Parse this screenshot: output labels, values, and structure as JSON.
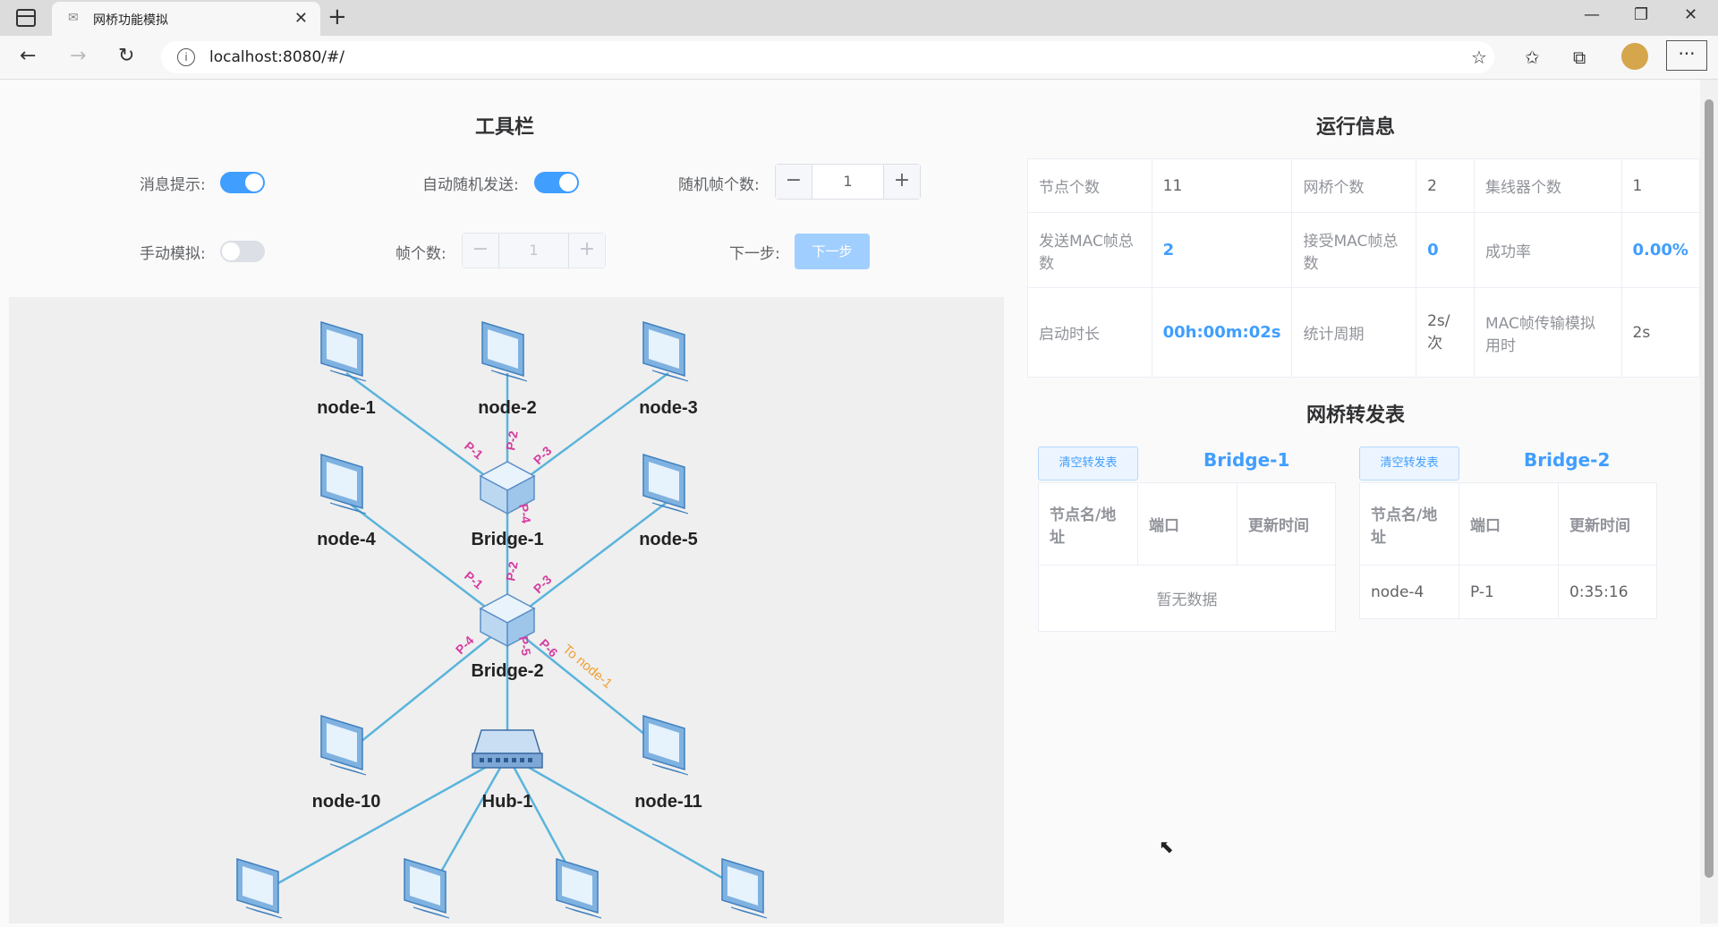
{
  "browser": {
    "tab_title": "网桥功能模拟",
    "url": "localhost:8080/#/"
  },
  "toolbar": {
    "title": "工具栏",
    "msg_hint_label": "消息提示:",
    "msg_hint_on": true,
    "auto_send_label": "自动随机发送:",
    "auto_send_on": true,
    "random_frames_label": "随机帧个数:",
    "random_frames_value": "1",
    "manual_label": "手动模拟:",
    "manual_on": false,
    "frame_count_label": "帧个数:",
    "frame_count_value": "1",
    "next_step_label": "下一步:",
    "next_step_button": "下一步"
  },
  "topology": {
    "nodes": [
      "node-1",
      "node-2",
      "node-3",
      "node-4",
      "node-5",
      "node-10",
      "node-11"
    ],
    "bridges": [
      "Bridge-1",
      "Bridge-2"
    ],
    "hub": "Hub-1",
    "bridge1_ports": [
      "P-1",
      "P-2",
      "P-3",
      "P-4"
    ],
    "bridge2_ports": [
      "P-1",
      "P-2",
      "P-3",
      "P-4",
      "P-5",
      "P-6"
    ],
    "frame_label": "To node-1",
    "colors": {
      "link": "#5ab4dc",
      "port": "#d63ca0",
      "frame": "#f0a030"
    }
  },
  "run_info": {
    "title": "运行信息",
    "rows": [
      [
        {
          "k": "节点个数",
          "v": "11"
        },
        {
          "k": "网桥个数",
          "v": "2"
        },
        {
          "k": "集线器个数",
          "v": "1"
        }
      ],
      [
        {
          "k": "发送MAC帧总数",
          "v": "2",
          "hl": true
        },
        {
          "k": "接受MAC帧总数",
          "v": "0",
          "hl": true
        },
        {
          "k": "成功率",
          "v": "0.00%",
          "hl": true
        }
      ],
      [
        {
          "k": "启动时长",
          "v": "00h:00m:02s",
          "hl": true
        },
        {
          "k": "统计周期",
          "v": "2s/次"
        },
        {
          "k": "MAC帧传输模拟用时",
          "v": "2s"
        }
      ]
    ]
  },
  "forward": {
    "title": "网桥转发表",
    "clear_label": "清空转发表",
    "headers": [
      "节点名/地址",
      "端口",
      "更新时间"
    ],
    "empty_text": "暂无数据",
    "bridge1": {
      "name": "Bridge-1",
      "rows": []
    },
    "bridge2": {
      "name": "Bridge-2",
      "rows": [
        [
          "node-4",
          "P-1",
          "0:35:16"
        ]
      ]
    }
  },
  "colors": {
    "accent": "#409eff",
    "accent_light": "#a0cfff"
  }
}
